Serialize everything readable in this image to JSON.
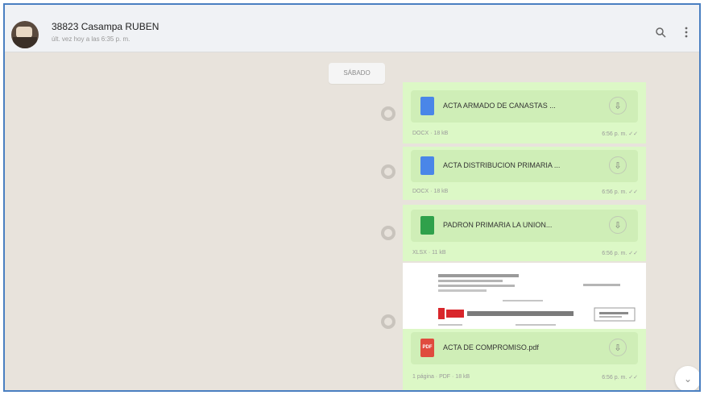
{
  "chat": {
    "contact_name": "38823 Casampa RUBEN",
    "status": "últ. vez hoy a las 6:35 p. m.",
    "search_icon": "search-icon",
    "menu_icon": "kebab-menu-icon"
  },
  "date_chip": "SÁBADO",
  "messages": [
    {
      "icon_label": "",
      "icon_color": "#4a86e8",
      "filename": "ACTA ARMADO DE CANASTAS ...",
      "meta": "DOCX · 18 kB",
      "time": "6:56 p. m. ✓✓"
    },
    {
      "icon_label": "",
      "icon_color": "#4a86e8",
      "filename": "ACTA DISTRIBUCION PRIMARIA ...",
      "meta": "DOCX · 18 kB",
      "time": "6:56 p. m. ✓✓"
    },
    {
      "icon_label": "",
      "icon_color": "#2fa14b",
      "filename": "PADRON PRIMARIA LA UNION...",
      "meta": "XLSX · 11 kB",
      "time": "6:56 p. m. ✓✓"
    },
    {
      "icon_label": "PDF",
      "icon_color": "#e04b3e",
      "filename": "ACTA DE COMPROMISO.pdf",
      "meta": "1 página · PDF · 18 kB",
      "time": "6:56 p. m. ✓✓"
    }
  ],
  "download_glyph": "⇩",
  "scroll_down_glyph": "⌄"
}
